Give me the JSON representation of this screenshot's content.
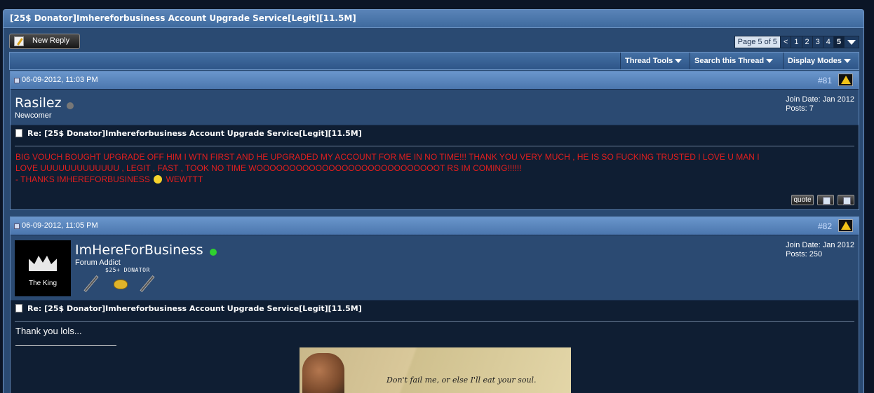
{
  "thread": {
    "title": "[25$ Donator]Imhereforbusiness Account Upgrade Service[Legit][11.5M]"
  },
  "toolbar": {
    "new_reply_label": "New Reply",
    "page_label": "Page 5 of 5",
    "page_prev": "<",
    "pages": [
      "1",
      "2",
      "3",
      "4",
      "5"
    ],
    "current_page": "5"
  },
  "thread_tools": {
    "items": [
      "Thread Tools",
      "Search this Thread",
      "Display Modes"
    ]
  },
  "posts": [
    {
      "date": "06-09-2012, 11:03 PM",
      "number": "#81",
      "username": "Rasilez",
      "online": false,
      "user_title": "Newcomer",
      "join_date": "Join Date: Jan 2012",
      "posts": "Posts: 7",
      "title": "Re: [25$ Donator]Imhereforbusiness Account Upgrade Service[Legit][11.5M]",
      "message_line1": "BIG VOUCH BOUGHT UPGRADE OFF HIM I WTN FIRST AND HE UPGRADED MY ACCOUNT FOR ME IN NO TIME!!! THANK YOU VERY MUCH , HE IS SO FUCKING TRUSTED I LOVE U MAN I",
      "message_line2": "LOVE UUUUUUUUUUUUU , LEGIT , FAST , TOOK NO TIME WOOOOOOOOOOOOOOOOOOOOOOOOOOOOT RS IM COMING!!!!!!",
      "message_line3a": "- THANKS IMHEREFORBUSINESS",
      "message_line3b": "WEWTTT",
      "quote_label": "quote"
    },
    {
      "date": "06-09-2012, 11:05 PM",
      "number": "#82",
      "username": "ImHereForBusiness",
      "online": true,
      "user_title": "Forum Addict",
      "rank_label": "$25+ DONATOR",
      "avatar_text": "The King",
      "join_date": "Join Date: Jan 2012",
      "posts": "Posts: 250",
      "title": "Re: [25$ Donator]Imhereforbusiness Account Upgrade Service[Legit][11.5M]",
      "message": "Thank you lols...",
      "signature_text": "Don't fail me, or else I'll eat your soul."
    }
  ],
  "colors": {
    "message_red": "#e21e1e",
    "online_green": "#2fd12f",
    "offline_gray": "#777777"
  }
}
